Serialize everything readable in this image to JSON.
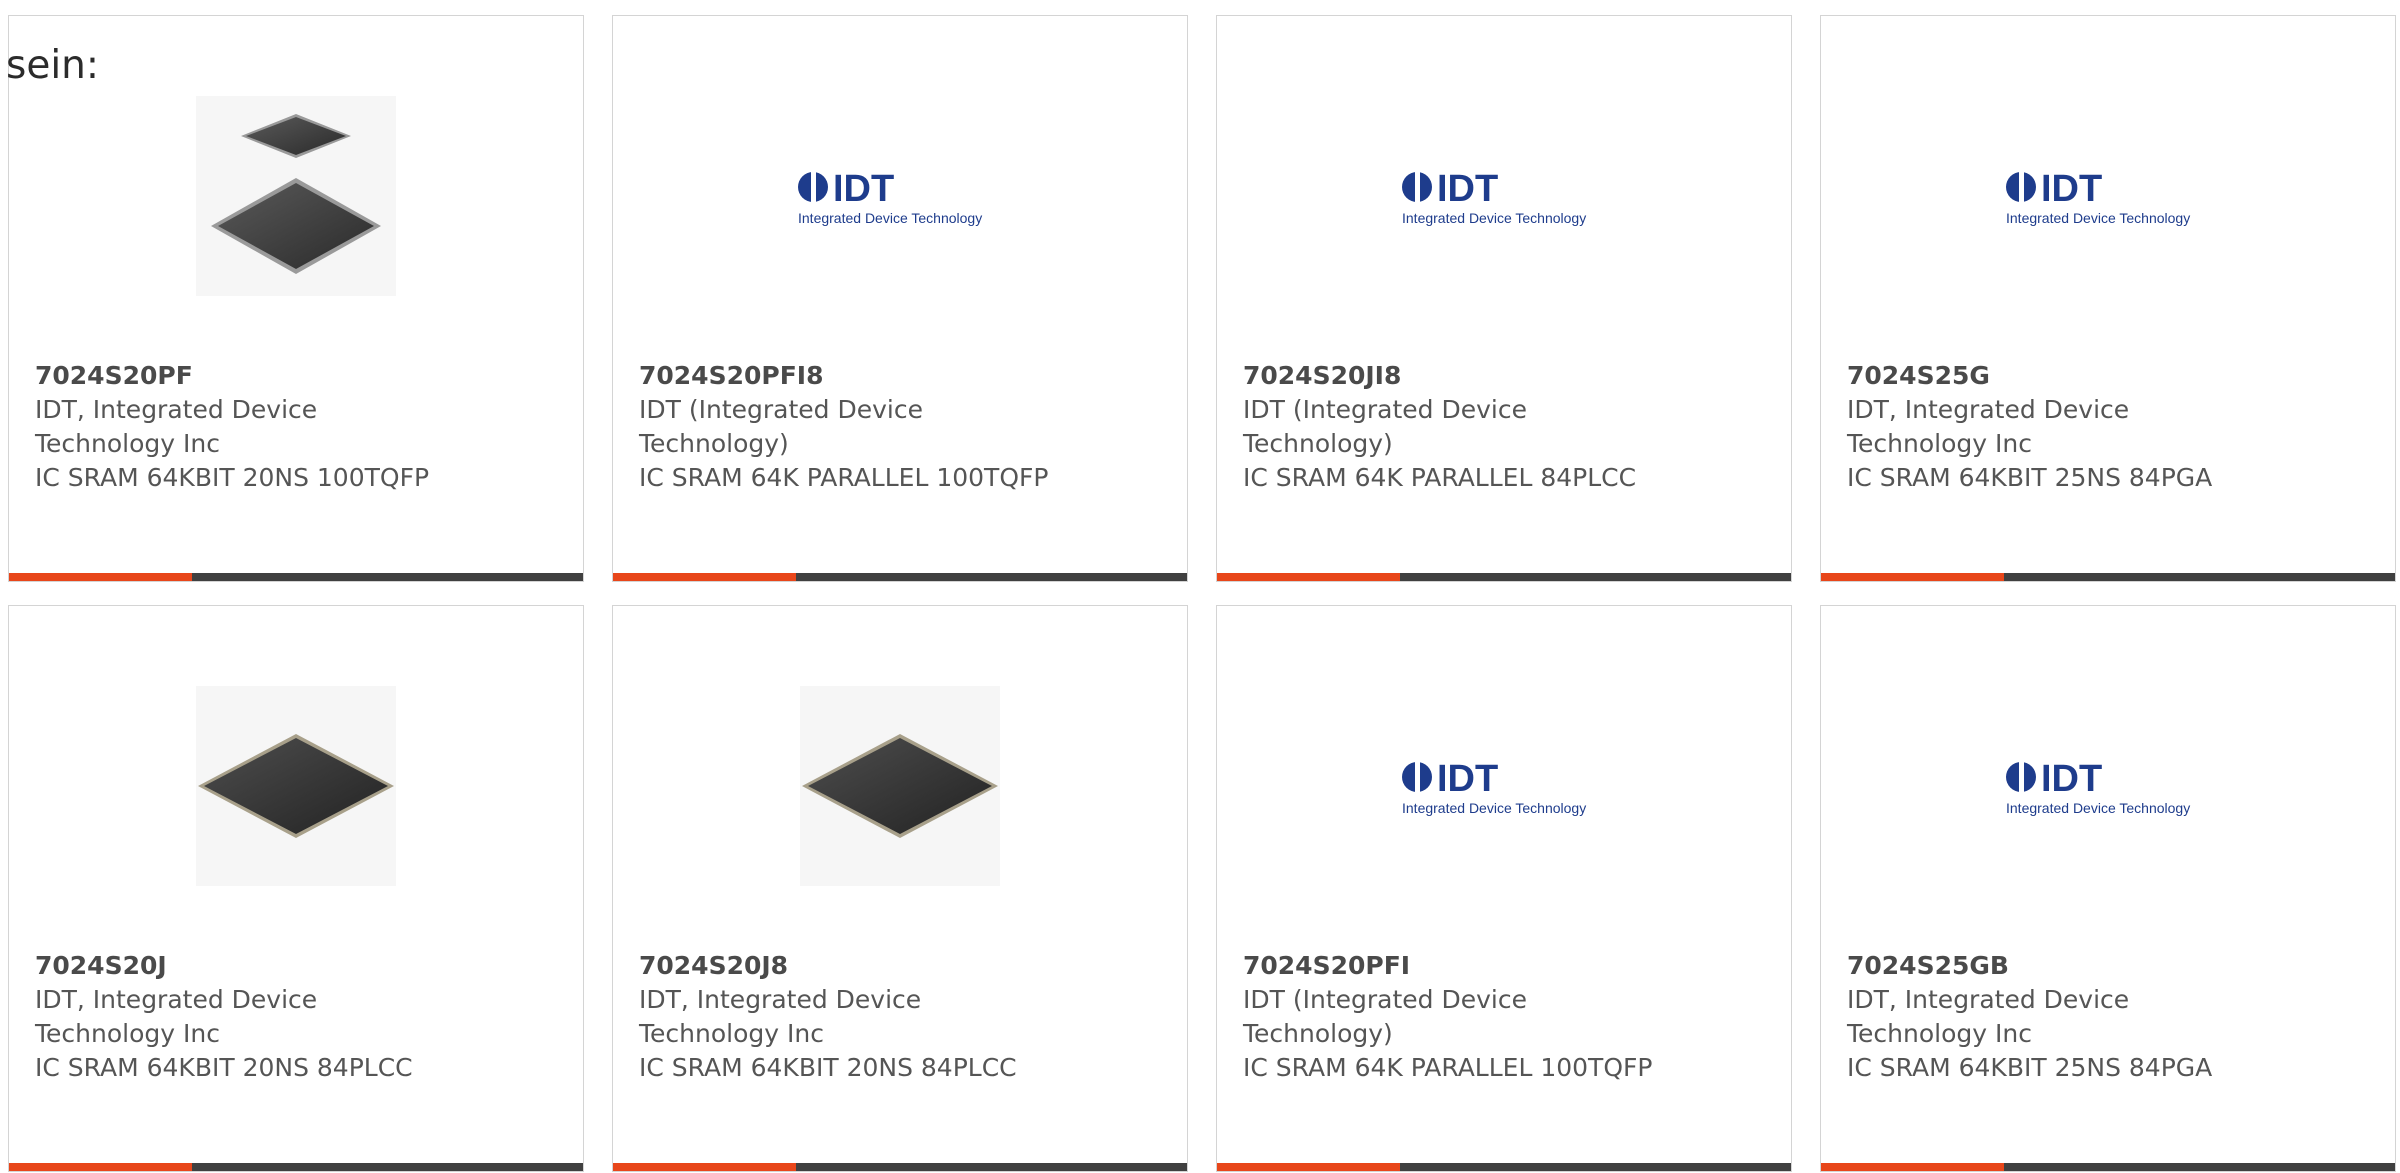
{
  "prefix_text": "sein:",
  "colors": {
    "accent": "#e8461a",
    "bar": "#404040",
    "border": "#d4d4d4",
    "text": "#555555"
  },
  "products": [
    {
      "part": "7024S20PF",
      "manufacturer": "IDT, Integrated Device Technology Inc",
      "description": "IC SRAM 64KBIT 20NS 100TQFP",
      "image": "chip-tqfp-two"
    },
    {
      "part": "7024S20PFI8",
      "manufacturer": "IDT (Integrated Device Technology)",
      "description": "IC SRAM 64K PARALLEL 100TQFP",
      "image": "idt-logo"
    },
    {
      "part": "7024S20JI8",
      "manufacturer": "IDT (Integrated Device Technology)",
      "description": "IC SRAM 64K PARALLEL 84PLCC",
      "image": "idt-logo"
    },
    {
      "part": "7024S25G",
      "manufacturer": "IDT, Integrated Device Technology Inc",
      "description": "IC SRAM 64KBIT 25NS 84PGA",
      "image": "idt-logo"
    },
    {
      "part": "7024S20J",
      "manufacturer": "IDT, Integrated Device Technology Inc",
      "description": "IC SRAM 64KBIT 20NS 84PLCC",
      "image": "chip-plcc"
    },
    {
      "part": "7024S20J8",
      "manufacturer": "IDT, Integrated Device Technology Inc",
      "description": "IC SRAM 64KBIT 20NS 84PLCC",
      "image": "chip-plcc"
    },
    {
      "part": "7024S20PFI",
      "manufacturer": "IDT (Integrated Device Technology)",
      "description": "IC SRAM 64K PARALLEL 100TQFP",
      "image": "idt-logo"
    },
    {
      "part": "7024S25GB",
      "manufacturer": "IDT, Integrated Device Technology Inc",
      "description": "IC SRAM 64KBIT 25NS 84PGA",
      "image": "idt-logo"
    }
  ],
  "logo": {
    "wordmark": "IDT",
    "tagline": "Integrated Device Technology"
  }
}
